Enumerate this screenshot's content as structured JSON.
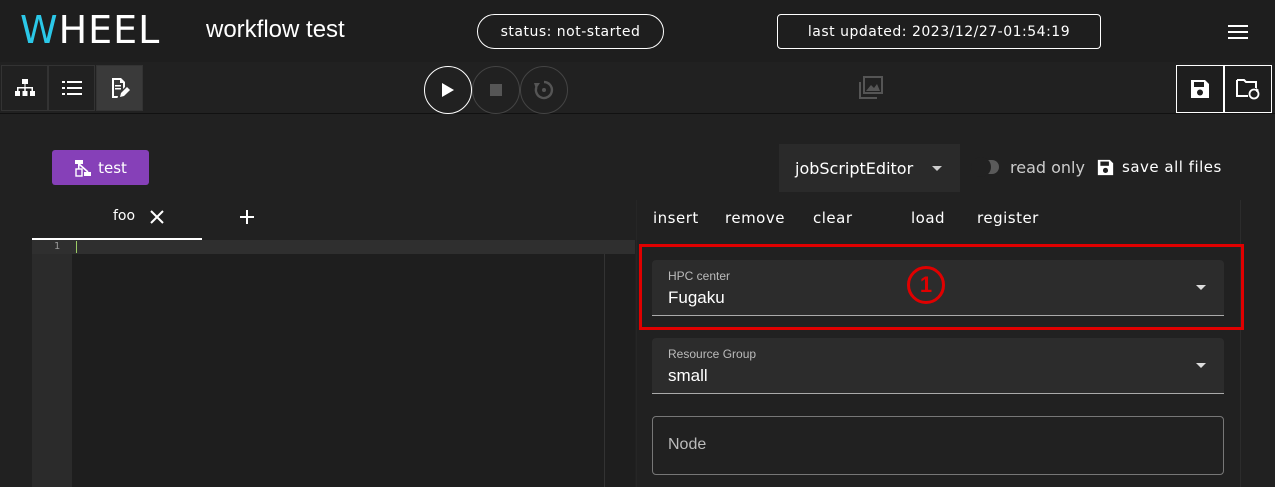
{
  "header": {
    "logo_first": "W",
    "logo_rest": "HEEL",
    "project_title": "workflow test",
    "status": "status: not-started",
    "last_updated": "last updated: 2023/12/27-01:54:19"
  },
  "component": {
    "name": "test"
  },
  "editor_controls": {
    "editor_select": "jobScriptEditor",
    "read_only_label": "read only",
    "save_all_label": "save all files"
  },
  "file_tabs": [
    {
      "label": "foo"
    }
  ],
  "code_editor": {
    "line_numbers": [
      "1"
    ]
  },
  "actions": {
    "insert": "insert",
    "remove": "remove",
    "clear": "clear",
    "load": "load",
    "register": "register"
  },
  "fields": {
    "hpc_center": {
      "label": "HPC center",
      "value": "Fugaku"
    },
    "resource_group": {
      "label": "Resource Group",
      "value": "small"
    },
    "node": {
      "placeholder": "Node"
    }
  },
  "annotation": {
    "marker": "1"
  },
  "colors": {
    "logo_accent": "#2bc8e8",
    "component_chip": "#8640b8",
    "highlight": "#e00000",
    "background": "#212121"
  },
  "icons": {
    "menu": "hamburger-menu-icon",
    "graph_view": "sitemap-icon",
    "list_view": "list-icon",
    "editor_view": "file-edit-icon",
    "run": "play-icon",
    "stop": "stop-icon",
    "reset": "reset-icon",
    "gallery": "image-gallery-icon",
    "save": "floppy-disk-icon",
    "project_files": "folder-sync-icon",
    "tab_close": "close-icon",
    "tab_add": "plus-icon"
  }
}
